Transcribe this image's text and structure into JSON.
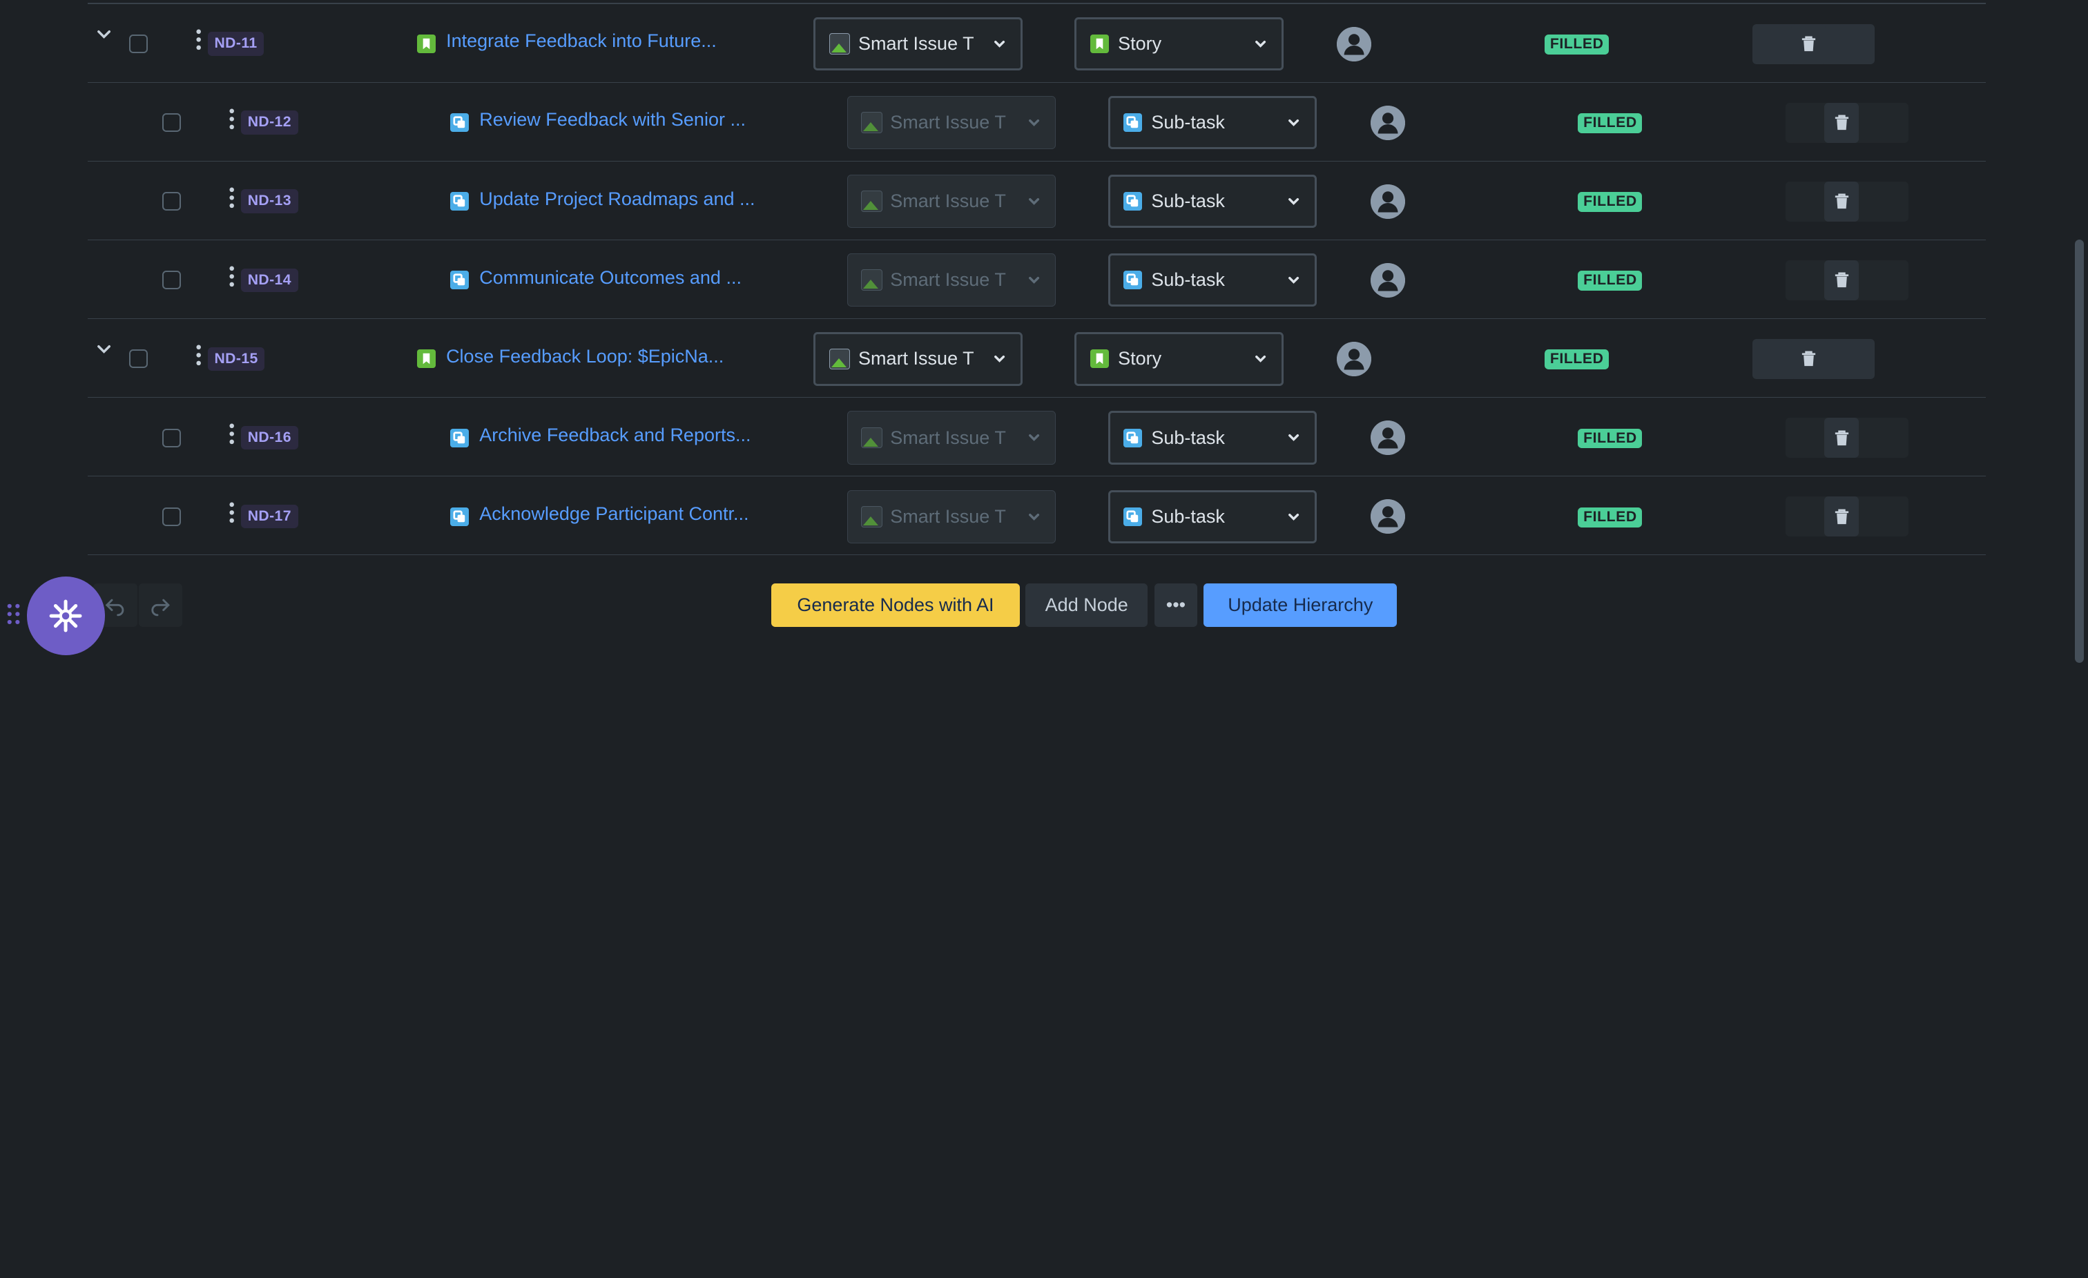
{
  "rows": [
    {
      "key": "ND-11",
      "title": "Integrate Feedback into Future...",
      "template": "Smart Issue T",
      "type": "Story",
      "status": "FILLED",
      "level": "parent"
    },
    {
      "key": "ND-12",
      "title": "Review Feedback with Senior ...",
      "template": "Smart Issue T",
      "type": "Sub-task",
      "status": "FILLED",
      "level": "child"
    },
    {
      "key": "ND-13",
      "title": "Update Project Roadmaps and ...",
      "template": "Smart Issue T",
      "type": "Sub-task",
      "status": "FILLED",
      "level": "child"
    },
    {
      "key": "ND-14",
      "title": "Communicate Outcomes and ...",
      "template": "Smart Issue T",
      "type": "Sub-task",
      "status": "FILLED",
      "level": "child"
    },
    {
      "key": "ND-15",
      "title": "Close Feedback Loop: $EpicNa...",
      "template": "Smart Issue T",
      "type": "Story",
      "status": "FILLED",
      "level": "parent"
    },
    {
      "key": "ND-16",
      "title": "Archive Feedback and Reports...",
      "template": "Smart Issue T",
      "type": "Sub-task",
      "status": "FILLED",
      "level": "child"
    },
    {
      "key": "ND-17",
      "title": "Acknowledge Participant Contr...",
      "template": "Smart Issue T",
      "type": "Sub-task",
      "status": "FILLED",
      "level": "child"
    }
  ],
  "footer": {
    "generate_label": "Generate Nodes with AI",
    "add_label": "Add Node",
    "more_label": "•••",
    "update_label": "Update Hierarchy"
  },
  "colors": {
    "background": "#1d2125",
    "link": "#579dff",
    "status_filled": "#4bce97",
    "generate_button": "#f5cd47",
    "update_button": "#579dff",
    "fab": "#6e5dc6"
  }
}
